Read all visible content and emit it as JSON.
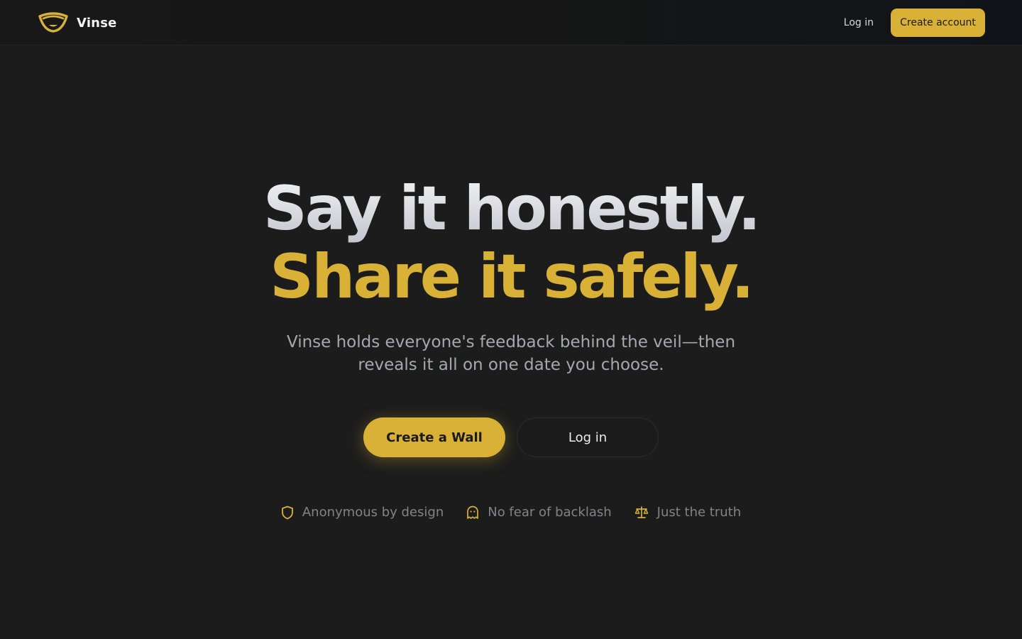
{
  "brand": {
    "name": "Vinse",
    "logo_icon": "mask-icon"
  },
  "nav": {
    "login_label": "Log in",
    "create_account_label": "Create account"
  },
  "hero": {
    "headline_line_1": "Say it honestly.",
    "headline_line_2": "Share it safely.",
    "subtitle": "Vinse holds everyone's feedback behind the veil—then reveals it all on one date you choose."
  },
  "cta": {
    "primary_label": "Create a Wall",
    "secondary_label": "Log in"
  },
  "features": [
    {
      "icon": "shield-icon",
      "label": "Anonymous by design"
    },
    {
      "icon": "ghost-icon",
      "label": "No fear of backlash"
    },
    {
      "icon": "scale-icon",
      "label": "Just the truth"
    }
  ],
  "colors": {
    "accent": "#d8b136",
    "background": "#1c1c1c",
    "muted_text": "#7f838c"
  }
}
